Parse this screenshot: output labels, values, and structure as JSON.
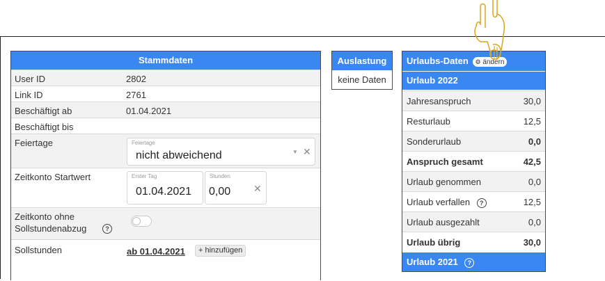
{
  "stammdaten": {
    "title": "Stammdaten",
    "rows": [
      {
        "label": "User ID",
        "value": "2802"
      },
      {
        "label": "Link ID",
        "value": "2761"
      },
      {
        "label": "Beschäftigt ab",
        "value": "01.04.2021"
      },
      {
        "label": "Beschäftigt bis",
        "value": ""
      }
    ],
    "feiertage": {
      "label": "Feiertage",
      "field_label": "Feiertage",
      "value": "nicht abweichend"
    },
    "zeitkonto_start": {
      "label": "Zeitkonto Startwert",
      "first_day_label": "Erster Tag",
      "first_day_value": "01.04.2021",
      "hours_label": "Stunden",
      "hours_value": "0,00"
    },
    "zeitkonto_ohne": {
      "label_line1": "Zeitkonto ohne",
      "label_line2": "Sollstundenabzug"
    },
    "sollstunden": {
      "label": "Sollstunden",
      "date_link": "ab 01.04.2021",
      "add_label": "+ hinzufügen"
    }
  },
  "auslastung": {
    "title": "Auslastung",
    "body": "keine Daten"
  },
  "urlaubsdaten": {
    "title": "Urlaubs-Daten",
    "edit_label": "ändern",
    "year_2022": "Urlaub 2022",
    "rows": [
      {
        "label": "Jahresanspruch",
        "value": "30,0"
      },
      {
        "label": "Resturlaub",
        "value": "12,5"
      },
      {
        "label": "Sonderurlaub",
        "value": "0,0"
      },
      {
        "label": "Anspruch gesamt",
        "value": "42,5"
      },
      {
        "label": "Urlaub genommen",
        "value": "0,0"
      },
      {
        "label": "Urlaub verfallen",
        "value": "12,5"
      },
      {
        "label": "Urlaub ausgezahlt",
        "value": "0,0"
      },
      {
        "label": "Urlaub übrig",
        "value": "30,0"
      }
    ],
    "year_2021": "Urlaub 2021"
  },
  "colors": {
    "header_blue": "#3b87f2",
    "row_alt": "#f2f2f2",
    "cursor_outline": "#d9a620"
  }
}
